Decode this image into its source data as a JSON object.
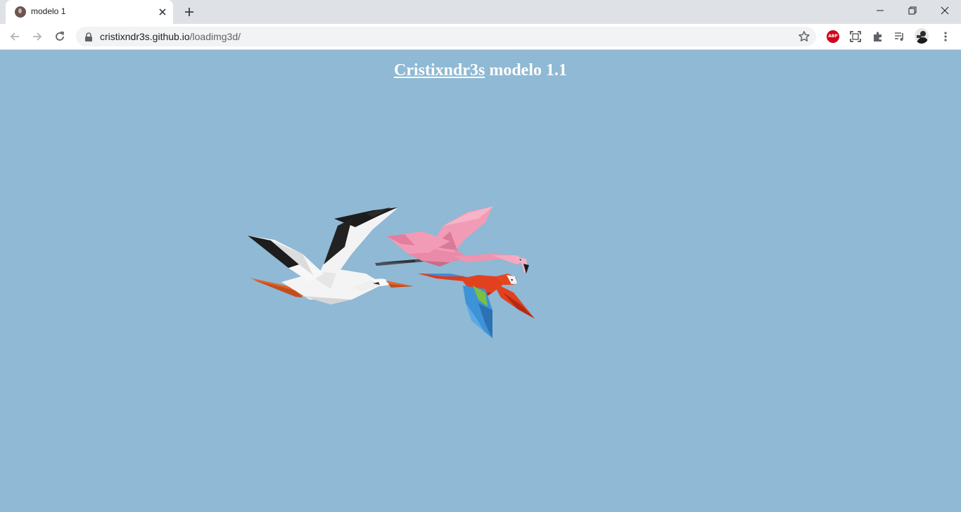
{
  "browser": {
    "tab_title": "modelo 1",
    "url_host": "cristixndr3s.github.io",
    "url_path": "/loadimg3d/",
    "extensions": [
      "abp-icon",
      "screen-capture-icon",
      "extensions-puzzle-icon",
      "media-queue-icon"
    ],
    "abp_label": "ABP"
  },
  "page": {
    "heading_link": "Cristixndr3s",
    "heading_rest": " modelo 1.1",
    "background_color": "#8fb9d4",
    "models": [
      "stork",
      "flamingo",
      "macaw"
    ]
  }
}
